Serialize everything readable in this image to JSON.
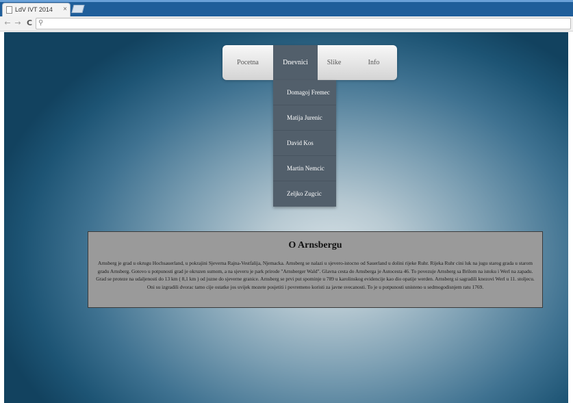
{
  "browser": {
    "tab_title": "LdV IVT 2014",
    "tab_close": "×",
    "back_icon": "←",
    "forward_icon": "→",
    "reload_icon": "C",
    "search_icon": "🔍",
    "address_value": ""
  },
  "nav": {
    "items": [
      {
        "label": "Pocetna"
      },
      {
        "label": "Dnevnici"
      },
      {
        "label": "Slike"
      },
      {
        "label": "Info"
      }
    ],
    "active_index": 1
  },
  "dropdown": {
    "items": [
      {
        "label": "Domagoj Fremec"
      },
      {
        "label": "Matija Jurenic"
      },
      {
        "label": "David Kos"
      },
      {
        "label": "Martin Nemcic"
      },
      {
        "label": "Zeljko Zugcic"
      }
    ]
  },
  "content": {
    "title": "O Arnsbergu",
    "text": "Arnsberg je grad u okrugu Hochsauerland, u pokrajini Sjeverna Rajna-Vestfalija, Njemacka. Arnsberg se nalazi u sjevero-istocno od Sauerland u dolini rijeke Ruhr. Rijeka Ruhr cini luk na jugu starog grada u starom gradu Arnsberg. Gotovo u potpunosti grad je okruzen sumom, a na sjeveru je park prirode \"Arnsberger Wald\". Glavna cesta do Arnsberga je Autocesta 46. To povezuje Arnsberg sa Brilom na istoku i Werl na zapadu. Grad se proteze na udaljenosti do 13 km ( 8,1 km ) od juzne do sjeverne granice. Arnsberg se prvi put spominje u 789 u karolinskog evidencije kao dio opatije werden. Arnsberg si sagradili knezovi Werl u 11. stoljecu. Oni su izgradili dvorac tamo cije ostatke jos uvijek mozete posjetiti i povremeno koristi za javne svecanosti. To je u potpunosti unisteno u sedmogodisnjem ratu 1769."
  },
  "colors": {
    "browser_frame": "#1f5e9a",
    "menu_active": "#525f6b",
    "content_box": "#9a9a9a",
    "page_edge": "#12425f",
    "page_center": "#d6e1e6"
  }
}
